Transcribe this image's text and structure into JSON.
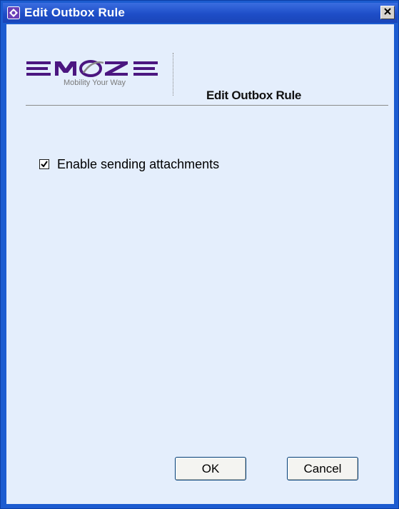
{
  "window": {
    "title": "Edit Outbox Rule",
    "close_label": "✕"
  },
  "header": {
    "logo_text": "EMOZE",
    "logo_tagline": "Mobility Your Way",
    "title": "Edit Outbox Rule"
  },
  "options": {
    "enable_attachments_label": "Enable sending attachments",
    "enable_attachments_checked": true
  },
  "buttons": {
    "ok_label": "OK",
    "cancel_label": "Cancel"
  },
  "colors": {
    "titlebar": "#1e4ec8",
    "client_bg": "#e4eefc",
    "logo_purple": "#4b1680"
  }
}
